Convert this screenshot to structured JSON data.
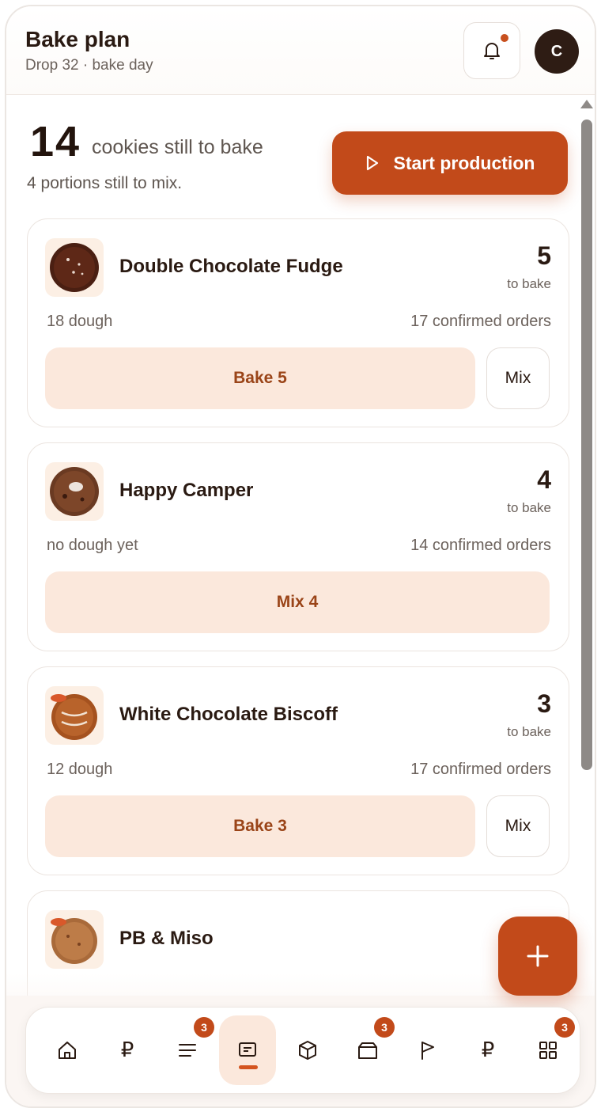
{
  "header": {
    "title": "Bake plan",
    "subtitle": "Drop 32 · bake day",
    "avatar_initial": "C"
  },
  "summary": {
    "count": "14",
    "count_label": "cookies still to bake",
    "sub": "4 portions still to mix.",
    "start_button": "Start production"
  },
  "cards": [
    {
      "name": "Double Chocolate Fudge",
      "to_bake": "5",
      "unit": "to bake",
      "dough": "18 dough",
      "orders": "17 confirmed orders",
      "action": "Bake 5",
      "mix": "Mix"
    },
    {
      "name": "Happy Camper",
      "to_bake": "4",
      "unit": "to bake",
      "dough": "no dough yet",
      "orders": "14 confirmed orders",
      "action": "Mix 4"
    },
    {
      "name": "White Chocolate Biscoff",
      "to_bake": "3",
      "unit": "to bake",
      "dough": "12 dough",
      "orders": "17 confirmed orders",
      "action": "Bake 3",
      "mix": "Mix"
    },
    {
      "name": "PB & Miso"
    }
  ],
  "nav": {
    "currency_symbol": "₽",
    "badges": {
      "orders": "3",
      "deliveries": "3",
      "more": "3"
    }
  },
  "colors": {
    "accent": "#c24a1a",
    "accent_soft": "#fbe8dc",
    "text_dark": "#2a1a12"
  }
}
